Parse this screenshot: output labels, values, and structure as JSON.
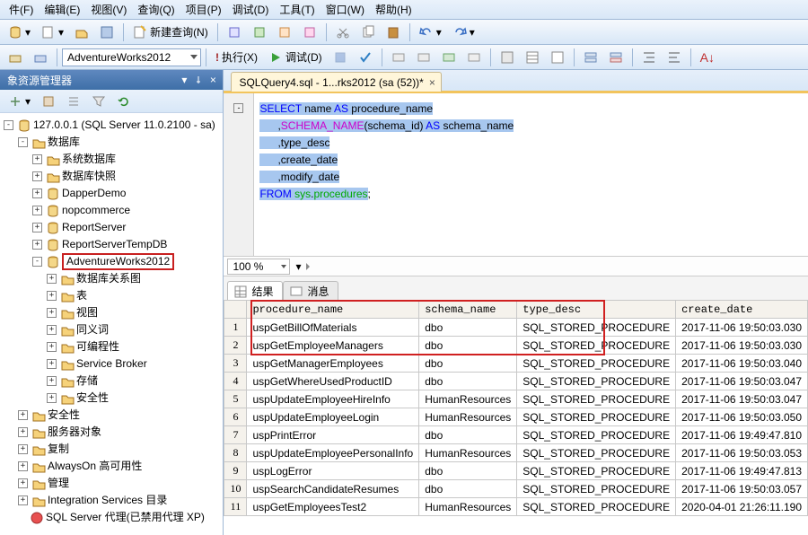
{
  "menu": {
    "items": [
      "件(F)",
      "编辑(E)",
      "视图(V)",
      "查询(Q)",
      "项目(P)",
      "调试(D)",
      "工具(T)",
      "窗口(W)",
      "帮助(H)"
    ]
  },
  "toolbar1": {
    "newquery_label": "新建查询(N)"
  },
  "toolbar2": {
    "db_selected": "AdventureWorks2012",
    "execute_label": "执行(X)",
    "debug_label": "调试(D)"
  },
  "panel": {
    "title": "象资源管理器",
    "server": "127.0.0.1 (SQL Server 11.0.2100 - sa)",
    "nodes": {
      "db": "数据库",
      "sysdb": "系统数据库",
      "snapshot": "数据库快照",
      "dapper": "DapperDemo",
      "nop": "nopcommerce",
      "rs": "ReportServer",
      "rstemp": "ReportServerTempDB",
      "adv": "AdventureWorks2012",
      "diagram": "数据库关系图",
      "tables": "表",
      "views": "视图",
      "synonyms": "同义词",
      "prog": "可编程性",
      "sb": "Service Broker",
      "storage": "存储",
      "security": "安全性",
      "security2": "安全性",
      "serverobj": "服务器对象",
      "repl": "复制",
      "always": "AlwaysOn 高可用性",
      "mgmt": "管理",
      "is": "Integration Services 目录",
      "agent": "SQL Server 代理(已禁用代理 XP)"
    }
  },
  "editor": {
    "tab_title": "SQLQuery4.sql - 1...rks2012 (sa (52))*",
    "zoom": "100 %",
    "sql": {
      "l1a": "SELECT",
      "l1b": " name ",
      "l1c": "AS",
      "l1d": " procedure_name",
      "l2a": "      ,",
      "l2b": "SCHEMA_NAME",
      "l2c": "(schema_id) ",
      "l2d": "AS",
      "l2e": " schema_name",
      "l3": "      ,type_desc",
      "l4": "      ,create_date",
      "l5": "      ,modify_date",
      "l6a": "FROM",
      "l6b": " sys",
      "l6c": ".",
      "l6d": "procedures",
      "l6e": ";"
    }
  },
  "results": {
    "tab1": "结果",
    "tab2": "消息",
    "columns": [
      "",
      "procedure_name",
      "schema_name",
      "type_desc",
      "create_date"
    ],
    "rows": [
      [
        "1",
        "uspGetBillOfMaterials",
        "dbo",
        "SQL_STORED_PROCEDURE",
        "2017-11-06 19:50:03.030"
      ],
      [
        "2",
        "uspGetEmployeeManagers",
        "dbo",
        "SQL_STORED_PROCEDURE",
        "2017-11-06 19:50:03.030"
      ],
      [
        "3",
        "uspGetManagerEmployees",
        "dbo",
        "SQL_STORED_PROCEDURE",
        "2017-11-06 19:50:03.040"
      ],
      [
        "4",
        "uspGetWhereUsedProductID",
        "dbo",
        "SQL_STORED_PROCEDURE",
        "2017-11-06 19:50:03.047"
      ],
      [
        "5",
        "uspUpdateEmployeeHireInfo",
        "HumanResources",
        "SQL_STORED_PROCEDURE",
        "2017-11-06 19:50:03.047"
      ],
      [
        "6",
        "uspUpdateEmployeeLogin",
        "HumanResources",
        "SQL_STORED_PROCEDURE",
        "2017-11-06 19:50:03.050"
      ],
      [
        "7",
        "uspPrintError",
        "dbo",
        "SQL_STORED_PROCEDURE",
        "2017-11-06 19:49:47.810"
      ],
      [
        "8",
        "uspUpdateEmployeePersonalInfo",
        "HumanResources",
        "SQL_STORED_PROCEDURE",
        "2017-11-06 19:50:03.053"
      ],
      [
        "9",
        "uspLogError",
        "dbo",
        "SQL_STORED_PROCEDURE",
        "2017-11-06 19:49:47.813"
      ],
      [
        "10",
        "uspSearchCandidateResumes",
        "dbo",
        "SQL_STORED_PROCEDURE",
        "2017-11-06 19:50:03.057"
      ],
      [
        "11",
        "uspGetEmployeesTest2",
        "HumanResources",
        "SQL_STORED_PROCEDURE",
        "2020-04-01 21:26:11.190"
      ]
    ]
  }
}
